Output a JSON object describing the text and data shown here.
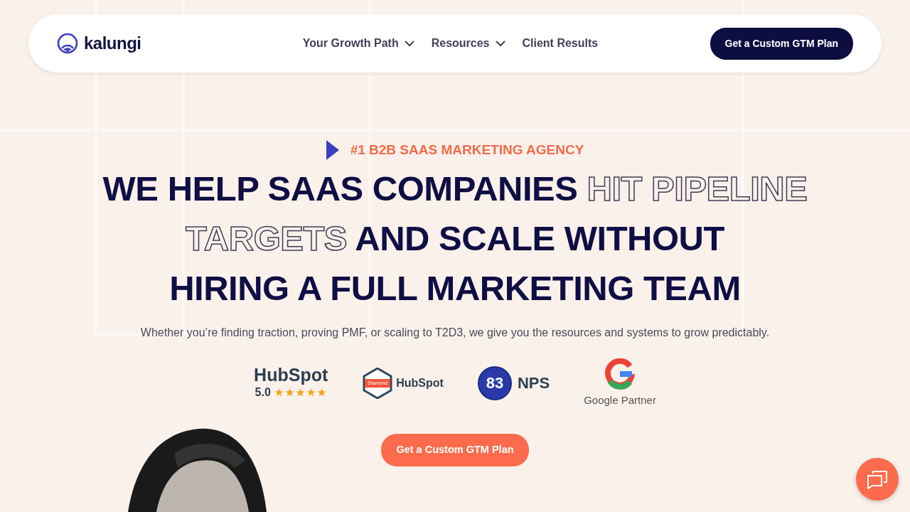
{
  "nav": {
    "logo": "kalungi",
    "items": [
      {
        "label": "Your Growth Path",
        "dropdown": true
      },
      {
        "label": "Resources",
        "dropdown": true
      },
      {
        "label": "Client Results",
        "dropdown": false
      }
    ],
    "cta": "Get a Custom GTM Plan"
  },
  "hero": {
    "eyebrow": "#1 B2B SAAS MARKETING AGENCY",
    "headline": [
      [
        {
          "text": "WE HELP SAAS COMPANIES ",
          "outline": false
        },
        {
          "text": "HIT PIPELINE",
          "outline": true
        }
      ],
      [
        {
          "text": "TARGETS",
          "outline": true
        },
        {
          "text": " AND SCALE WITHOUT",
          "outline": false
        }
      ],
      [
        {
          "text": "HIRING A FULL MARKETING TEAM",
          "outline": false
        }
      ]
    ],
    "subtitle": "Whether you’re finding traction, proving PMF, or scaling to T2D3, we give you the resources and systems to grow predictably.",
    "badges": [
      {
        "kind": "rating",
        "name": "HubSpot",
        "score": "5.0",
        "stars": 5
      },
      {
        "kind": "diamond",
        "tier": "Diamond",
        "name": "HubSpot"
      },
      {
        "kind": "nps",
        "score": "83",
        "name": "NPS"
      },
      {
        "kind": "google",
        "name": "Google Partner"
      }
    ],
    "cta": "Get a Custom GTM Plan"
  }
}
